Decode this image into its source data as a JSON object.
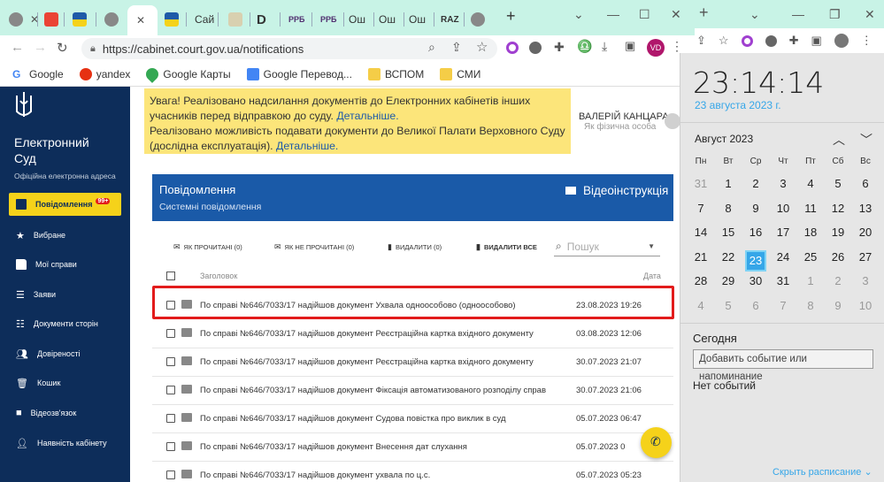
{
  "browser": {
    "tabs": [
      "",
      "",
      "",
      "",
      "",
      "Сай",
      "",
      "D",
      "PPБ",
      "PPБ",
      "Ош",
      "Ош",
      "Ош",
      "RAZ",
      "",
      "+"
    ],
    "url": "https://cabinet.court.gov.ua/notifications",
    "profile": "VD",
    "bookmarks": [
      "Google",
      "yandex",
      "Google Карты",
      "Google Перевод...",
      "ВСПОМ",
      "СМИ"
    ]
  },
  "sidebar": {
    "brand_line1": "Електронний",
    "brand_line2": "Суд",
    "brand_sub": "Офіційна електронна адреса",
    "items": [
      {
        "label": "Повідомлення",
        "badge": "99+"
      },
      {
        "label": "Вибране"
      },
      {
        "label": "Мої справи"
      },
      {
        "label": "Заяви"
      },
      {
        "label": "Документи сторін"
      },
      {
        "label": "Довіреності"
      },
      {
        "label": "Кошик"
      },
      {
        "label": "Відеозв'язок"
      },
      {
        "label": "Наявність кабінету"
      }
    ]
  },
  "banner": {
    "line1": "Увага! Реалізовано надсилання документів до Електронних кабінетів інших учасників перед відправкою до суду.",
    "link1": "Детальніше.",
    "line2": "Реалізовано можливість подавати документи до Великої Палати Верховного Суду (дослідна експлуатація).",
    "link2": "Детальніше."
  },
  "user": {
    "name": "ВАЛЕРІЙ КАНЦАРА",
    "type": "Як фізична особа"
  },
  "notifications": {
    "title": "Повідомлення",
    "subtitle": "Системні повідомлення",
    "video_label": "Відеоінструкція",
    "actions": [
      "ЯК ПРОЧИТАНІ (0)",
      "ЯК НЕ ПРОЧИТАНІ (0)",
      "ВИДАЛИТИ (0)",
      "ВИДАЛИТИ ВСЕ"
    ],
    "search_placeholder": "Пошук",
    "col_subject": "Заголовок",
    "col_date": "Дата",
    "rows": [
      {
        "subject": "По справі №646/7033/17 надійшов документ Ухвала одноособово (одноособово)",
        "date": "23.08.2023 19:26"
      },
      {
        "subject": "По справі №646/7033/17 надійшов документ Реєстраційна картка вхідного документу",
        "date": "03.08.2023 12:06"
      },
      {
        "subject": "По справі №646/7033/17 надійшов документ Реєстраційна картка вхідного документу",
        "date": "30.07.2023 21:07"
      },
      {
        "subject": "По справі №646/7033/17 надійшов документ Фіксація автоматизованого розподілу справ",
        "date": "30.07.2023 21:06"
      },
      {
        "subject": "По справі №646/7033/17 надійшов документ Судова повістка про виклик в суд",
        "date": "05.07.2023 06:47"
      },
      {
        "subject": "По справі №646/7033/17 надійшов документ Внесення дат слухання",
        "date": "05.07.2023 0"
      },
      {
        "subject": "По справі №646/7033/17 надійшов документ ухвала по ц.с.",
        "date": "05.07.2023 05:23"
      }
    ]
  },
  "calendar": {
    "time": "23:14:14",
    "date": "23 августа 2023 г.",
    "month": "Август 2023",
    "dows": [
      "Пн",
      "Вт",
      "Ср",
      "Чт",
      "Пт",
      "Сб",
      "Вс"
    ],
    "days": [
      "31",
      "1",
      "2",
      "3",
      "4",
      "5",
      "6",
      "7",
      "8",
      "9",
      "10",
      "11",
      "12",
      "13",
      "14",
      "15",
      "16",
      "17",
      "18",
      "19",
      "20",
      "21",
      "22",
      "23",
      "24",
      "25",
      "26",
      "27",
      "28",
      "29",
      "30",
      "31",
      "1",
      "2",
      "3",
      "4",
      "5",
      "6",
      "7",
      "8",
      "9",
      "10"
    ],
    "today_label": "Сегодня",
    "event_placeholder": "Добавить событие или напоминание",
    "no_events": "Нет событий",
    "hide_schedule": "Скрыть расписание"
  }
}
